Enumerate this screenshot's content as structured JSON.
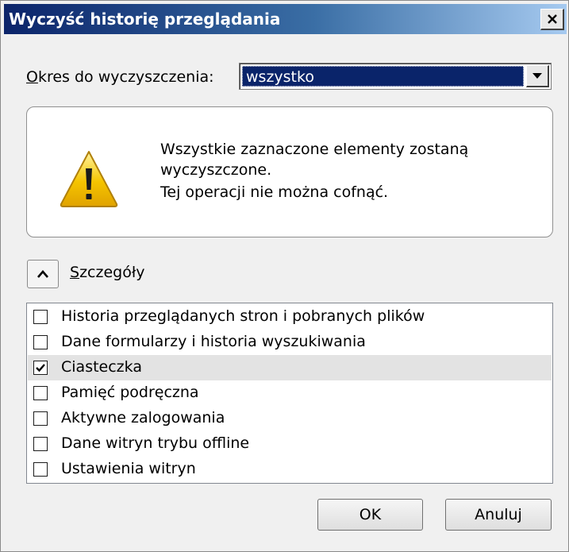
{
  "window": {
    "title": "Wyczyść historię przeglądania"
  },
  "period": {
    "label_access_key": "O",
    "label_rest": "kres do wyczyszczenia:",
    "selected_value": "wszystko"
  },
  "warning": {
    "icon": "warning-icon",
    "line1": "Wszystkie zaznaczone elementy zostaną wyczyszczone.",
    "line2": "Tej operacji nie można cofnąć."
  },
  "details": {
    "toggle_icon": "chevron-up-icon",
    "label_access_key": "S",
    "label_rest": "zczegóły"
  },
  "items": [
    {
      "label": "Historia przeglądanych stron i pobranych plików",
      "checked": false
    },
    {
      "label": "Dane formularzy i historia wyszukiwania",
      "checked": false
    },
    {
      "label": "Ciasteczka",
      "checked": true
    },
    {
      "label": "Pamięć podręczna",
      "checked": false
    },
    {
      "label": "Aktywne zalogowania",
      "checked": false
    },
    {
      "label": "Dane witryn trybu offline",
      "checked": false
    },
    {
      "label": "Ustawienia witryn",
      "checked": false
    }
  ],
  "buttons": {
    "ok": "OK",
    "cancel": "Anuluj"
  },
  "colors": {
    "title_gradient_start": "#0b246a",
    "title_gradient_end": "#a6caf0",
    "selection": "#0a246a",
    "warning_yellow": "#f5c400"
  }
}
